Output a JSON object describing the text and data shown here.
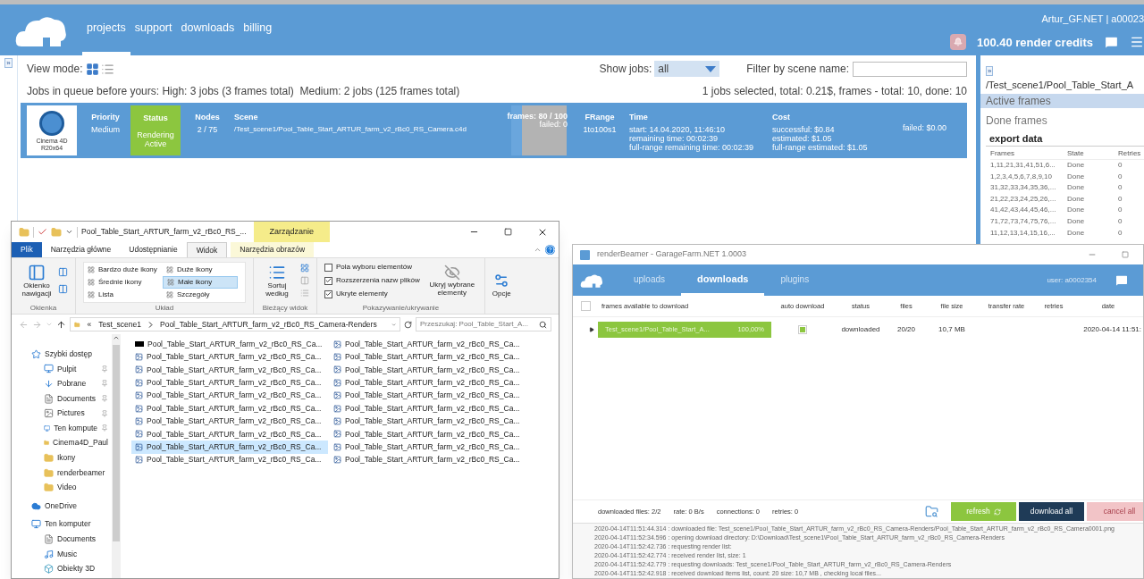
{
  "site": {
    "nav": [
      {
        "label": "projects",
        "selected": true
      },
      {
        "label": "support",
        "selected": false
      },
      {
        "label": "downloads",
        "selected": false
      },
      {
        "label": "billing",
        "selected": false
      }
    ],
    "account": "Artur_GF.NET | a00023",
    "credits": "100.40 render credits",
    "expand_toggle": "»"
  },
  "jobs": {
    "view_mode_label": "View mode:",
    "show_jobs_label": "Show jobs:",
    "show_jobs_value": "all",
    "filter_label": "Filter by scene name:",
    "queue_info": "Jobs in queue before yours: High: 3 jobs (3 frames total)  Medium: 2 jobs (125 frames total)",
    "selection_info": "1 jobs selected, total: 0.21$, frames - total: 10, done: 10",
    "rows": [
      {
        "software": "Cinema 4D",
        "software_version": "R20x64",
        "priority_label": "Priority",
        "priority": "Medium",
        "status_label": "Status",
        "status": "Rendering Active",
        "nodes_label": "Nodes",
        "nodes": "2 / 75",
        "scene_label": "Scene",
        "scene": "/Test_scene1/Pool_Table_Start_ARTUR_farm_v2_rBc0_RS_Camera.c4d",
        "frames": "frames: 80 / 100",
        "frames_failed": "failed: 0",
        "level": 0.8,
        "frange_label": "FRange",
        "frange": "1to100s1",
        "time_label": "Time",
        "time_lines": [
          "start: 14.04.2020, 11:46:10",
          "remaining time: 00:02:39",
          "full-range remaining time: 00:02:39"
        ],
        "cost_label": "Cost",
        "cost_lines": [
          "successful: $0.84",
          "estimated: $1.05",
          "full-range estimated: $1.05"
        ],
        "failed_cost": "failed: $0.00"
      }
    ]
  },
  "side_panel": {
    "toggle": "»",
    "path": "/Test_scene1/Pool_Table_Start_A",
    "lists": [
      {
        "label": "Active frames",
        "selected": true
      },
      {
        "label": "Done frames",
        "selected": false
      }
    ],
    "export": "export data",
    "columns": [
      "Frames",
      "State",
      "Retries"
    ],
    "rows": [
      [
        "1,11,21,31,41,51,6...",
        "Done",
        "0"
      ],
      [
        "1,2,3,4,5,6,7,8,9,10",
        "Done",
        "0"
      ],
      [
        "31,32,33,34,35,36,...",
        "Done",
        "0"
      ],
      [
        "21,22,23,24,25,26,...",
        "Done",
        "0"
      ],
      [
        "41,42,43,44,45,46,...",
        "Done",
        "0"
      ],
      [
        "71,72,73,74,75,76,...",
        "Done",
        "0"
      ],
      [
        "11,12,13,14,15,16,...",
        "Done",
        "0"
      ]
    ]
  },
  "explorer": {
    "title": "Pool_Table_Start_ARTUR_farm_v2_rBc0_RS_...",
    "context_header": "Zarządzanie",
    "tabs": [
      {
        "label": "Plik",
        "kind": "file",
        "selected": false
      },
      {
        "label": "Narzędzia główne",
        "kind": "normal",
        "selected": false
      },
      {
        "label": "Udostępnianie",
        "kind": "normal",
        "selected": false
      },
      {
        "label": "Widok",
        "kind": "normal",
        "selected": true
      },
      {
        "label": "Narzędzia obrazów",
        "kind": "context",
        "selected": false
      }
    ],
    "nav_pane": {
      "label": "Okienko nawigacji",
      "group": "Okienka"
    },
    "layouts": [
      {
        "label": "Bardzo duże ikony",
        "selected": false
      },
      {
        "label": "Duże ikony",
        "selected": false
      },
      {
        "label": "Średnie ikony",
        "selected": false
      },
      {
        "label": "Małe ikony",
        "selected": true
      },
      {
        "label": "Lista",
        "selected": false
      },
      {
        "label": "Szczegóły",
        "selected": false
      }
    ],
    "layout_group": "Układ",
    "sort": {
      "label": "Sortuj według",
      "group": "Bieżący widok"
    },
    "options": [
      {
        "label": "Pola wyboru elementów",
        "checked": false
      },
      {
        "label": "Rozszerzenia nazw plików",
        "checked": true
      },
      {
        "label": "Ukryte elementy",
        "checked": true
      }
    ],
    "hide_selected": "Ukryj wybrane elementy",
    "show_group": "Pokazywanie/ukrywanie",
    "options_button": "Opcje",
    "breadcrumb": [
      "Test_scene1",
      "Pool_Table_Start_ARTUR_farm_v2_rBc0_RS_Camera-Renders"
    ],
    "breadcrumb_prefix": "«",
    "search": {
      "placeholder": "Przeszukaj: Pool_Table_Start_A..."
    },
    "tree": [
      {
        "label": "Szybki dostęp",
        "kind": "star",
        "children": [
          {
            "label": "Pulpit",
            "kind": "desktop",
            "pinned": true
          },
          {
            "label": "Pobrane",
            "kind": "download",
            "pinned": true
          },
          {
            "label": "Documents",
            "kind": "document",
            "pinned": true
          },
          {
            "label": "Pictures",
            "kind": "pictures",
            "pinned": true
          },
          {
            "label": "Ten kompute",
            "kind": "computer",
            "pinned": true
          },
          {
            "label": "Cinema4D_Paul",
            "kind": "folder",
            "pinned": false
          },
          {
            "label": "Ikony",
            "kind": "folder",
            "pinned": false
          },
          {
            "label": "renderbeamer",
            "kind": "folder",
            "pinned": false
          },
          {
            "label": "Video",
            "kind": "folder",
            "pinned": false
          }
        ]
      },
      {
        "label": "OneDrive",
        "kind": "cloud"
      },
      {
        "label": "Ten komputer",
        "kind": "computer",
        "children": [
          {
            "label": "Documents",
            "kind": "document"
          },
          {
            "label": "Music",
            "kind": "music"
          },
          {
            "label": "Obiekty 3D",
            "kind": "cube"
          }
        ]
      }
    ],
    "files": [
      {
        "name": "Pool_Table_Start_ARTUR_farm_v2_rBc0_RS_Ca...",
        "kind": "dark",
        "selected": false
      },
      {
        "name": "Pool_Table_Start_ARTUR_farm_v2_rBc0_RS_Ca...",
        "kind": "image",
        "selected": false
      },
      {
        "name": "Pool_Table_Start_ARTUR_farm_v2_rBc0_RS_Ca...",
        "kind": "image",
        "selected": false
      },
      {
        "name": "Pool_Table_Start_ARTUR_farm_v2_rBc0_RS_Ca...",
        "kind": "image",
        "selected": false
      },
      {
        "name": "Pool_Table_Start_ARTUR_farm_v2_rBc0_RS_Ca...",
        "kind": "image",
        "selected": false
      },
      {
        "name": "Pool_Table_Start_ARTUR_farm_v2_rBc0_RS_Ca...",
        "kind": "image",
        "selected": false
      },
      {
        "name": "Pool_Table_Start_ARTUR_farm_v2_rBc0_RS_Ca...",
        "kind": "image",
        "selected": false
      },
      {
        "name": "Pool_Table_Start_ARTUR_farm_v2_rBc0_RS_Ca...",
        "kind": "image",
        "selected": false
      },
      {
        "name": "Pool_Table_Start_ARTUR_farm_v2_rBc0_RS_Ca...",
        "kind": "image",
        "selected": true
      },
      {
        "name": "Pool_Table_Start_ARTUR_farm_v2_rBc0_RS_Ca...",
        "kind": "image",
        "selected": false
      },
      {
        "name": "Pool_Table_Start_ARTUR_farm_v2_rBc0_RS_Ca...",
        "kind": "image",
        "selected": false
      },
      {
        "name": "Pool_Table_Start_ARTUR_farm_v2_rBc0_RS_Ca...",
        "kind": "image",
        "selected": false
      },
      {
        "name": "Pool_Table_Start_ARTUR_farm_v2_rBc0_RS_Ca...",
        "kind": "image",
        "selected": false
      },
      {
        "name": "Pool_Table_Start_ARTUR_farm_v2_rBc0_RS_Ca...",
        "kind": "image",
        "selected": false
      },
      {
        "name": "Pool_Table_Start_ARTUR_farm_v2_rBc0_RS_Ca...",
        "kind": "image",
        "selected": false
      },
      {
        "name": "Pool_Table_Start_ARTUR_farm_v2_rBc0_RS_Ca...",
        "kind": "image",
        "selected": false
      },
      {
        "name": "Pool_Table_Start_ARTUR_farm_v2_rBc0_RS_Ca...",
        "kind": "image",
        "selected": false
      },
      {
        "name": "Pool_Table_Start_ARTUR_farm_v2_rBc0_RS_Ca...",
        "kind": "image",
        "selected": false
      },
      {
        "name": "Pool_Table_Start_ARTUR_farm_v2_rBc0_RS_Ca...",
        "kind": "image",
        "selected": false
      },
      {
        "name": "Pool_Table_Start_ARTUR_farm_v2_rBc0_RS_Ca...",
        "kind": "image",
        "selected": false
      }
    ]
  },
  "beamer": {
    "title": "renderBeamer - GarageFarm.NET 1.0003",
    "tabs": [
      {
        "label": "uploads",
        "selected": false
      },
      {
        "label": "downloads",
        "selected": true
      },
      {
        "label": "plugins",
        "selected": false
      }
    ],
    "user": "user: a0002354",
    "columns": [
      "frames available to download",
      "auto download",
      "status",
      "files",
      "file size",
      "transfer rate",
      "retries",
      "date"
    ],
    "rows": [
      {
        "name": "Test_scene1/Pool_Table_Start_A...",
        "percent": "100,00%",
        "level": 1,
        "auto_download": true,
        "status": "downloaded",
        "files": "20/20",
        "size": "10,7 MB",
        "date": "2020-04-14 11:51:"
      }
    ],
    "select_all_checked": false,
    "stats": [
      "downloaded files: 2/2",
      "rate: 0 B/s",
      "connections: 0",
      "retries: 0"
    ],
    "buttons": [
      {
        "label": "refresh",
        "kind": "refresh",
        "disabled": false
      },
      {
        "label": "download all",
        "kind": "primary",
        "disabled": false
      },
      {
        "label": "cancel all",
        "kind": "danger",
        "disabled": true
      }
    ],
    "log": [
      "2020-04-14T11:51:44.314 : downloaded file: Test_scene1/Pool_Table_Start_ARTUR_farm_v2_rBc0_RS_Camera-Renders/Pool_Table_Start_ARTUR_farm_v2_rBc0_RS_Camera0001.png",
      "2020-04-14T11:52:34.596 : opening download directory: D:\\Download\\Test_scene1\\Pool_Table_Start_ARTUR_farm_v2_rBc0_RS_Camera-Renders",
      "2020-04-14T11:52:42.736 : requesting render list:",
      "2020-04-14T11:52:42.774 : received render list, size: 1",
      "2020-04-14T11:52:42.779 : requesting downloads: Test_scene1/Pool_Table_Start_ARTUR_farm_v2_rBc0_RS_Camera-Renders",
      "2020-04-14T11:52:42.918 : received download items list, count: 20 size: 10,7 MB , checking local files..."
    ]
  }
}
